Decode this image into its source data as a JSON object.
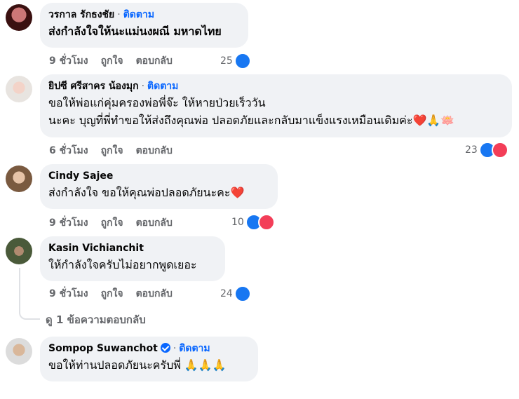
{
  "comments": [
    {
      "name": "วรกาล รักธงชัย",
      "follow": "ติดตาม",
      "text": "ส่งกำลังใจให้นะแม่นงผณี มหาดไทย",
      "time": "9 ชั่วโมง",
      "like": "ถูกใจ",
      "reply": "ตอบกลับ",
      "reactions": "25",
      "reaction_icons": [
        "like-icon"
      ]
    },
    {
      "name": "ยิปซี ศรีสาคร น้องมุก",
      "follow": "ติดตาม",
      "text_lines": [
        "ขอให้พ่อแก่คุ่มครองพ่อพี่จ๊ะ ให้หายป่วยเร็ววัน",
        "นะคะ บุญที่พี่ทำขอให้ส่งถึงคุณพ่อ ปลอดภัยและกลับมาแข็งแรงเหมือนเดิมค่ะ❤️🙏🪷"
      ],
      "time": "6 ชั่วโมง",
      "like": "ถูกใจ",
      "reply": "ตอบกลับ",
      "reactions": "23",
      "reaction_icons": [
        "like-icon",
        "love-icon"
      ]
    },
    {
      "name": "Cindy Sajee",
      "text": "ส่งกำลังใจ ขอให้คุณพ่อปลอดภัยนะคะ❤️",
      "time": "9 ชั่วโมง",
      "like": "ถูกใจ",
      "reply": "ตอบกลับ",
      "reactions": "10",
      "reaction_icons": [
        "like-icon",
        "love-icon"
      ]
    },
    {
      "name": "Kasin Vichianchit",
      "text": "ให้กำลังใจครับไม่อยากพูดเยอะ",
      "time": "9 ชั่วโมง",
      "like": "ถูกใจ",
      "reply": "ตอบกลับ",
      "reactions": "24",
      "reaction_icons": [
        "like-icon"
      ]
    },
    {
      "name": "Sompop Suwanchot",
      "follow": "ติดตาม",
      "text": "ขอให้ท่านปลอดภัยนะครับพี่ 🙏🙏🙏",
      "time": "",
      "like": "",
      "reply": ""
    }
  ],
  "view_replies": "ดู 1 ข้อความตอบกลับ",
  "colors": {
    "link": "#0866ff",
    "like": "#1877f2",
    "love": "#f33e58",
    "bubble": "#f0f2f5",
    "meta": "#65676b"
  }
}
